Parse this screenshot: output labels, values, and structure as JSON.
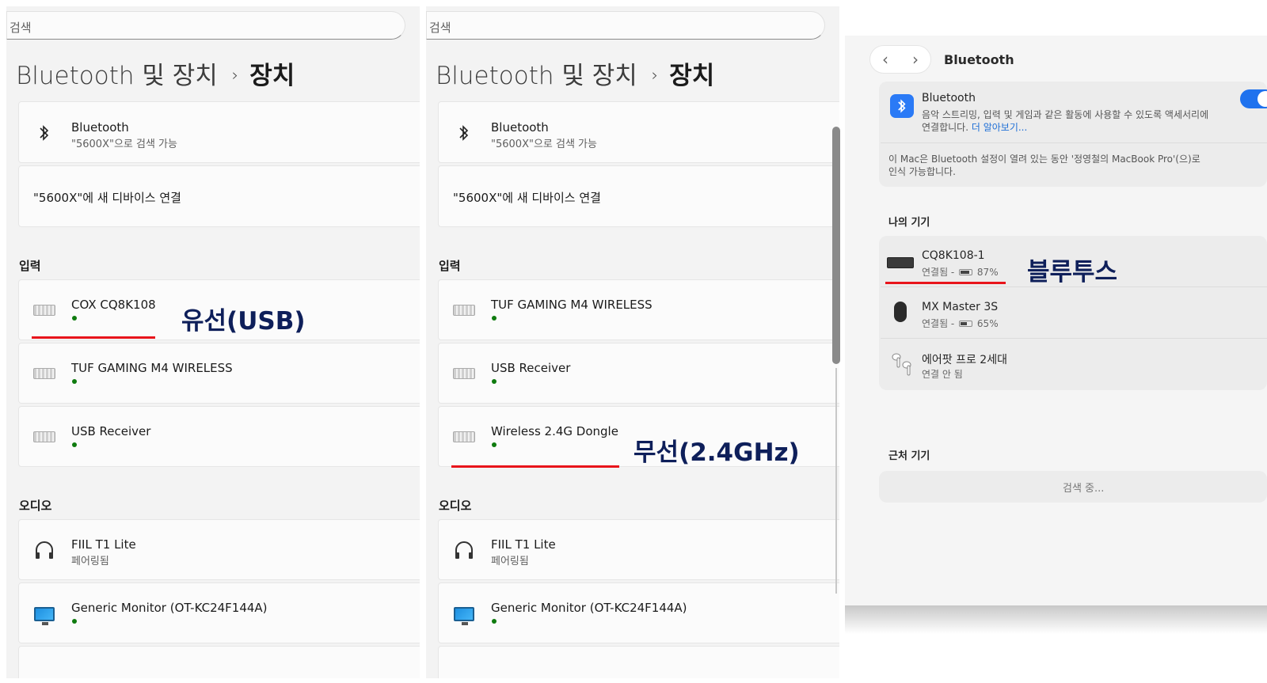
{
  "windows_panels": [
    {
      "search_placeholder": "검색",
      "breadcrumb": {
        "parent": "Bluetooth 및 장치",
        "separator": "›",
        "current": "장치"
      },
      "bluetooth_card": {
        "title": "Bluetooth",
        "subtitle": "\"5600X\"으로 검색 가능"
      },
      "add_device_label": "\"5600X\"에 새 디바이스 연결",
      "input_section_label": "입력",
      "input_devices": [
        "COX CQ8K108",
        "TUF GAMING M4 WIRELESS",
        "USB Receiver"
      ],
      "audio_section_label": "오디오",
      "audio_device": {
        "name": "FIIL T1 Lite",
        "status": "페어링됨"
      },
      "monitor_device": "Generic Monitor (OT-KC24F144A)"
    },
    {
      "search_placeholder": "검색",
      "breadcrumb": {
        "parent": "Bluetooth 및 장치",
        "separator": "›",
        "current": "장치"
      },
      "bluetooth_card": {
        "title": "Bluetooth",
        "subtitle": "\"5600X\"으로 검색 가능"
      },
      "add_device_label": "\"5600X\"에 새 디바이스 연결",
      "input_section_label": "입력",
      "input_devices": [
        "TUF GAMING M4 WIRELESS",
        "USB Receiver",
        "Wireless 2.4G Dongle"
      ],
      "audio_section_label": "오디오",
      "audio_device": {
        "name": "FIIL T1 Lite",
        "status": "페어링됨"
      },
      "monitor_device": "Generic Monitor (OT-KC24F144A)"
    }
  ],
  "annotations": {
    "wired": "유선(USB)",
    "wireless": "무선(2.4GHz)",
    "bluetooth": "블루투스"
  },
  "mac": {
    "nav_back": "‹",
    "nav_forward": "›",
    "title": "Bluetooth",
    "bt_card": {
      "title": "Bluetooth",
      "description_line1": "음악 스트리밍, 입력 및 게임과 같은 활동에 사용할 수 있도록 액세서리에",
      "description_line2": "연결합니다.",
      "learn_more": "더 알아보기...",
      "discoverable_line1": "이 Mac은 Bluetooth 설정이 열려 있는 동안 '정영철의 MacBook Pro'(으)로",
      "discoverable_line2": "인식 가능합니다."
    },
    "my_devices_label": "나의 기기",
    "devices": [
      {
        "name": "CQ8K108-1",
        "status": "연결됨 -",
        "battery": "87%",
        "battery_fraction": 0.87
      },
      {
        "name": "MX Master 3S",
        "status": "연결됨 -",
        "battery": "65%",
        "battery_fraction": 0.65
      },
      {
        "name": "에어팟 프로 2세대",
        "status": "연결 안 됨"
      }
    ],
    "nearby_label": "근처 기기",
    "searching": "검색 중..."
  },
  "colors": {
    "accent_blue": "#1f72ee",
    "status_green": "#0f7b0f",
    "annotation_red": "#e8141b",
    "annotation_navy": "#0e1f5a"
  }
}
